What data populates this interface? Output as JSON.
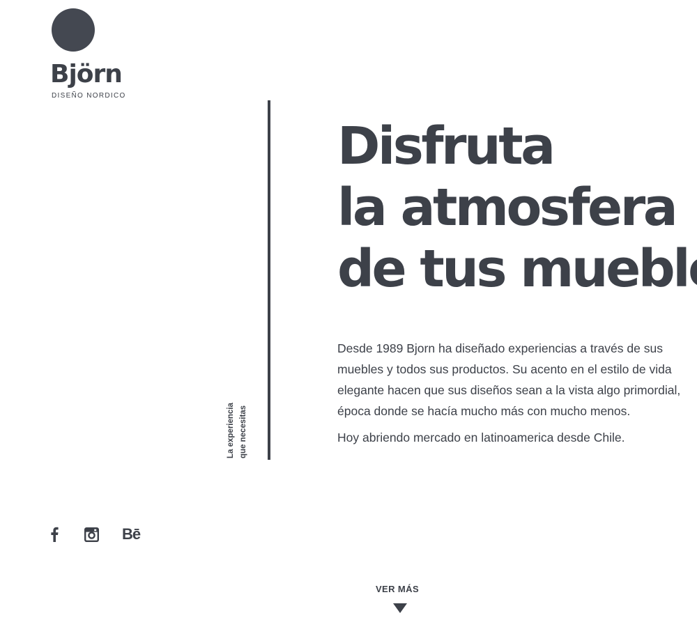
{
  "brand": {
    "name": "Björn",
    "tagline": "DISEÑO NORDICO"
  },
  "side_caption": {
    "line1": "La experiencia",
    "line2": "que necesitas"
  },
  "hero": {
    "line1": "Disfruta",
    "line2": "la atmosfera",
    "line3": "de tus muebles"
  },
  "intro": {
    "paragraph1_lines": [
      "Desde 1989 Bjorn ha diseñado experiencias a través de sus",
      "muebles y todos sus productos. Su acento en el estilo de vida",
      "elegante hacen que sus diseños sean a la vista algo primordial,",
      "época donde se hacía mucho más con mucho menos."
    ],
    "paragraph2": "Hoy abriendo mercado en latinoamerica desde Chile."
  },
  "social": {
    "facebook_icon": "facebook-icon",
    "instagram_icon": "instagram-icon",
    "behance_icon": "behance-icon",
    "behance_text": "Bē"
  },
  "cta": {
    "see_more_label": "VER MÁS",
    "arrow_icon": "triangle-down-icon"
  },
  "colors": {
    "text": "#3d4149",
    "logo": "#444851",
    "background": "#ffffff"
  }
}
